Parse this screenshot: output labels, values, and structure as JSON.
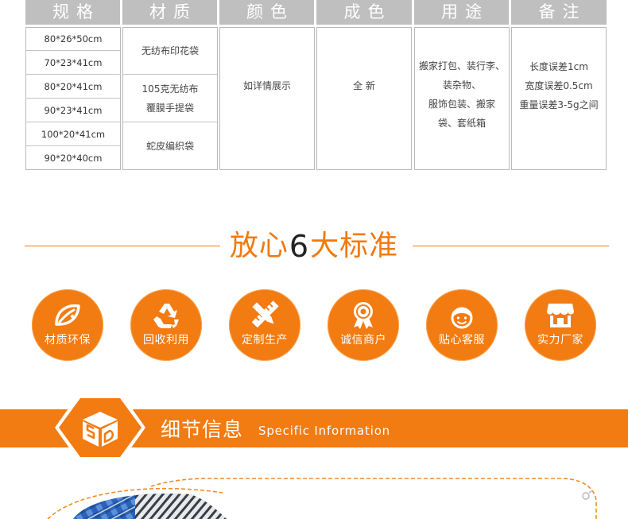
{
  "spec_table": {
    "headers": [
      "规格",
      "材质",
      "颜色",
      "成色",
      "用途",
      "备注"
    ],
    "sizes": [
      "80*26*50cm",
      "70*23*41cm",
      "80*20*41cm",
      "90*23*41cm",
      "100*20*41cm",
      "90*20*40cm"
    ],
    "materials": [
      {
        "lines": [
          "无纺布印花袋"
        ]
      },
      {
        "lines": [
          "105克无纺布",
          "覆膜手提袋"
        ]
      },
      {
        "lines": [
          "蛇皮编织袋"
        ]
      }
    ],
    "color": "如详情展示",
    "condition": "全 新",
    "usage_lines": [
      "搬家打包、装行李、",
      "装杂物、",
      "服饰包装、搬家",
      "袋、套纸箱"
    ],
    "notes_lines": [
      "长度误差1cm",
      "宽度误差0.5cm",
      "重量误差3-5g之间"
    ]
  },
  "standards": {
    "title_prefix": "放心",
    "title_number": "6",
    "title_suffix": "大标准",
    "items": [
      {
        "label": "材质环保",
        "icon": "eco-leaf-icon"
      },
      {
        "label": "回收利用",
        "icon": "recycle-icon"
      },
      {
        "label": "定制生产",
        "icon": "pencil-ruler-icon"
      },
      {
        "label": "诚信商户",
        "icon": "medal-icon"
      },
      {
        "label": "贴心客服",
        "icon": "customer-service-icon"
      },
      {
        "label": "实力厂家",
        "icon": "storefront-icon"
      }
    ]
  },
  "detail_banner": {
    "title_cn": "细节信息",
    "title_en": "Specific Information",
    "logo_icon": "sd-logo-icon"
  },
  "colors": {
    "accent": "#f27b12",
    "header_gray": "#bfbfbf",
    "border": "#b9b9b9"
  }
}
